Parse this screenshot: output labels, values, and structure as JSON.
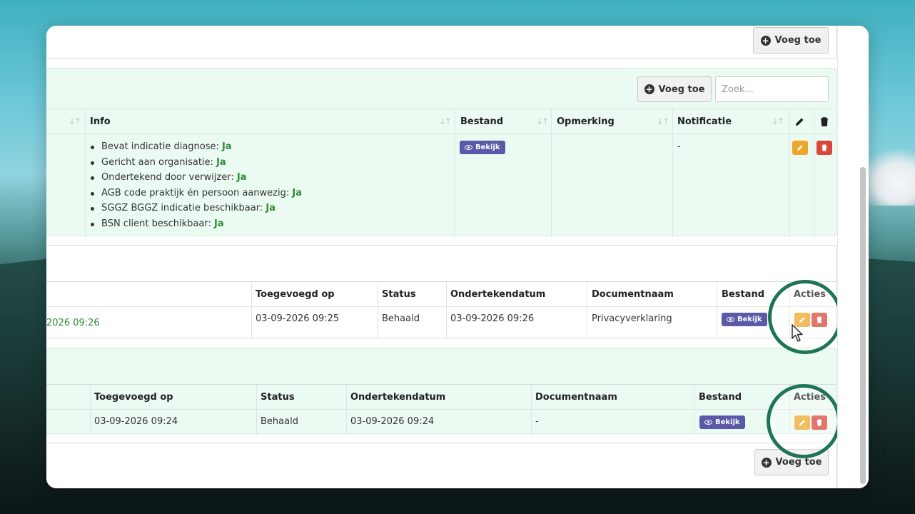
{
  "colors": {
    "accent_green": "#2f8a39",
    "badge": "#5b5aa8",
    "edit": "#eea72b",
    "delete": "#d9473b",
    "highlight": "#1f7455"
  },
  "top_panel": {
    "add_label": "Voeg toe"
  },
  "indication_panel": {
    "add_label": "Voeg toe",
    "search_placeholder": "Zoek...",
    "headers": {
      "info": "Info",
      "bestand": "Bestand",
      "opmerking": "Opmerking",
      "notificatie": "Notificatie"
    },
    "info_items": [
      {
        "label": "Bevat indicatie diagnose:",
        "value": "Ja"
      },
      {
        "label": "Gericht aan organisatie:",
        "value": "Ja"
      },
      {
        "label": "Ondertekend door verwijzer:",
        "value": "Ja"
      },
      {
        "label": "AGB code praktijk én persoon aanwezig:",
        "value": "Ja"
      },
      {
        "label": "SGGZ BGGZ indicatie beschikbaar:",
        "value": "Ja"
      },
      {
        "label": "BSN client beschikbaar:",
        "value": "Ja"
      }
    ],
    "bestand_label": "Bekijk",
    "notificatie_value": "-"
  },
  "privacy_panel": {
    "headers": {
      "toegevoegd": "Toegevoegd op",
      "status": "Status",
      "ondertekend": "Ondertekendatum",
      "documentnaam": "Documentnaam",
      "bestand": "Bestand",
      "acties": "Acties"
    },
    "row": {
      "partial_date": "2026 09:26",
      "toegevoegd": "03-09-2026 09:25",
      "status": "Behaald",
      "ondertekend": "03-09-2026 09:26",
      "documentnaam": "Privacyverklaring",
      "bestand_label": "Bekijk"
    }
  },
  "third_panel": {
    "headers": {
      "toegevoegd": "Toegevoegd op",
      "status": "Status",
      "ondertekend": "Ondertekendatum",
      "documentnaam": "Documentnaam",
      "bestand": "Bestand",
      "acties": "Acties"
    },
    "row": {
      "toegevoegd": "03-09-2026 09:24",
      "status": "Behaald",
      "ondertekend": "03-09-2026 09:24",
      "documentnaam": "-",
      "bestand_label": "Bekijk"
    }
  },
  "bottom_panel": {
    "add_label": "Voeg toe"
  }
}
